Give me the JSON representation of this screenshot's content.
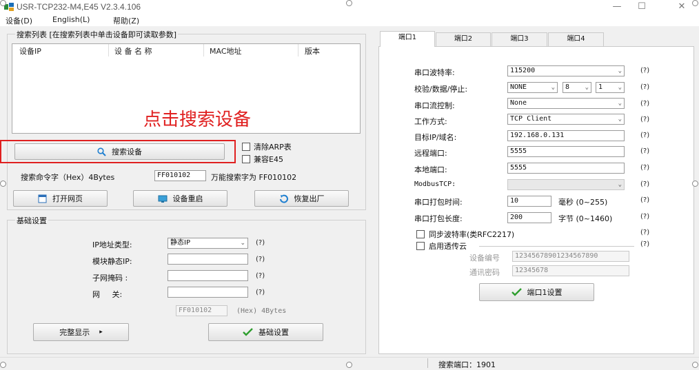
{
  "window": {
    "title": "USR-TCP232-M4,E45 V2.3.4.106",
    "minimize_glyph": "—",
    "maximize_glyph": "☐",
    "close_glyph": "✕"
  },
  "menu": [
    "设备(D)",
    "English(L)",
    "帮助(Z)"
  ],
  "search_group": {
    "title": "搜索列表 [在搜索列表中单击设备即可读取参数]",
    "columns": [
      "设备IP",
      "设 备 名 称",
      "MAC地址",
      "版本"
    ],
    "annotation": "点击搜索设备",
    "search_button": "搜索设备",
    "clear_arp_label": "清除ARP表",
    "compat_label": "兼容E45",
    "cmd_label": "搜索命令字（Hex）4Bytes",
    "cmd_value": "FF010102",
    "cmd_hint": "万能搜索字为 FF010102",
    "open_web_button": "打开网页",
    "restart_button": "设备重启",
    "factory_button": "恢复出厂"
  },
  "basic_group": {
    "title": "基础设置",
    "ip_type_label": "IP地址类型:",
    "ip_type_value": "静态IP",
    "static_ip_label": "模块静态IP:",
    "subnet_label": "子网掩码 :",
    "gateway_label": "网     关:",
    "help": "(?)",
    "hex_value": "FF010102",
    "hex_label": "(Hex) 4Bytes",
    "full_display_button": "完整显示",
    "full_display_arrow": "▸",
    "basic_save_button": "基础设置"
  },
  "tabs": [
    "端口1",
    "端口2",
    "端口3",
    "端口4"
  ],
  "port": {
    "baud_label": "串口波特率:",
    "baud_value": "115200",
    "parity_label": "校验/数据/停止:",
    "parity_value": "NONE",
    "data_bits": "8",
    "stop_bits": "1",
    "flow_label": "串口流控制:",
    "flow_value": "None",
    "mode_label": "工作方式:",
    "mode_value": "TCP Client",
    "target_label": "目标IP/域名:",
    "target_value": "192.168.0.131",
    "remote_port_label": "远程端口:",
    "remote_port_value": "5555",
    "local_port_label": "本地端口:",
    "local_port_value": "5555",
    "modbus_label": "ModbusTCP:",
    "modbus_value": "",
    "pack_time_label": "串口打包时间:",
    "pack_time_value": "10",
    "pack_time_unit": "毫秒 (0~255)",
    "pack_len_label": "串口打包长度:",
    "pack_len_value": "200",
    "pack_len_unit": "字节 (0~1460)",
    "sync_baud_label": "同步波特率(类RFC2217)",
    "cloud_label": "启用透传云",
    "device_no_label": "设备编号",
    "device_no_value": "12345678901234567890",
    "comm_pwd_label": "通讯密码",
    "comm_pwd_value": "12345678",
    "port_save_button": "端口1设置",
    "help": "(?)"
  },
  "status": {
    "search_port": "搜索端口：1901"
  },
  "colors": {
    "annotation": "#e02020",
    "highlight_border": "#e02020",
    "check_green": "#2e9e2e"
  }
}
